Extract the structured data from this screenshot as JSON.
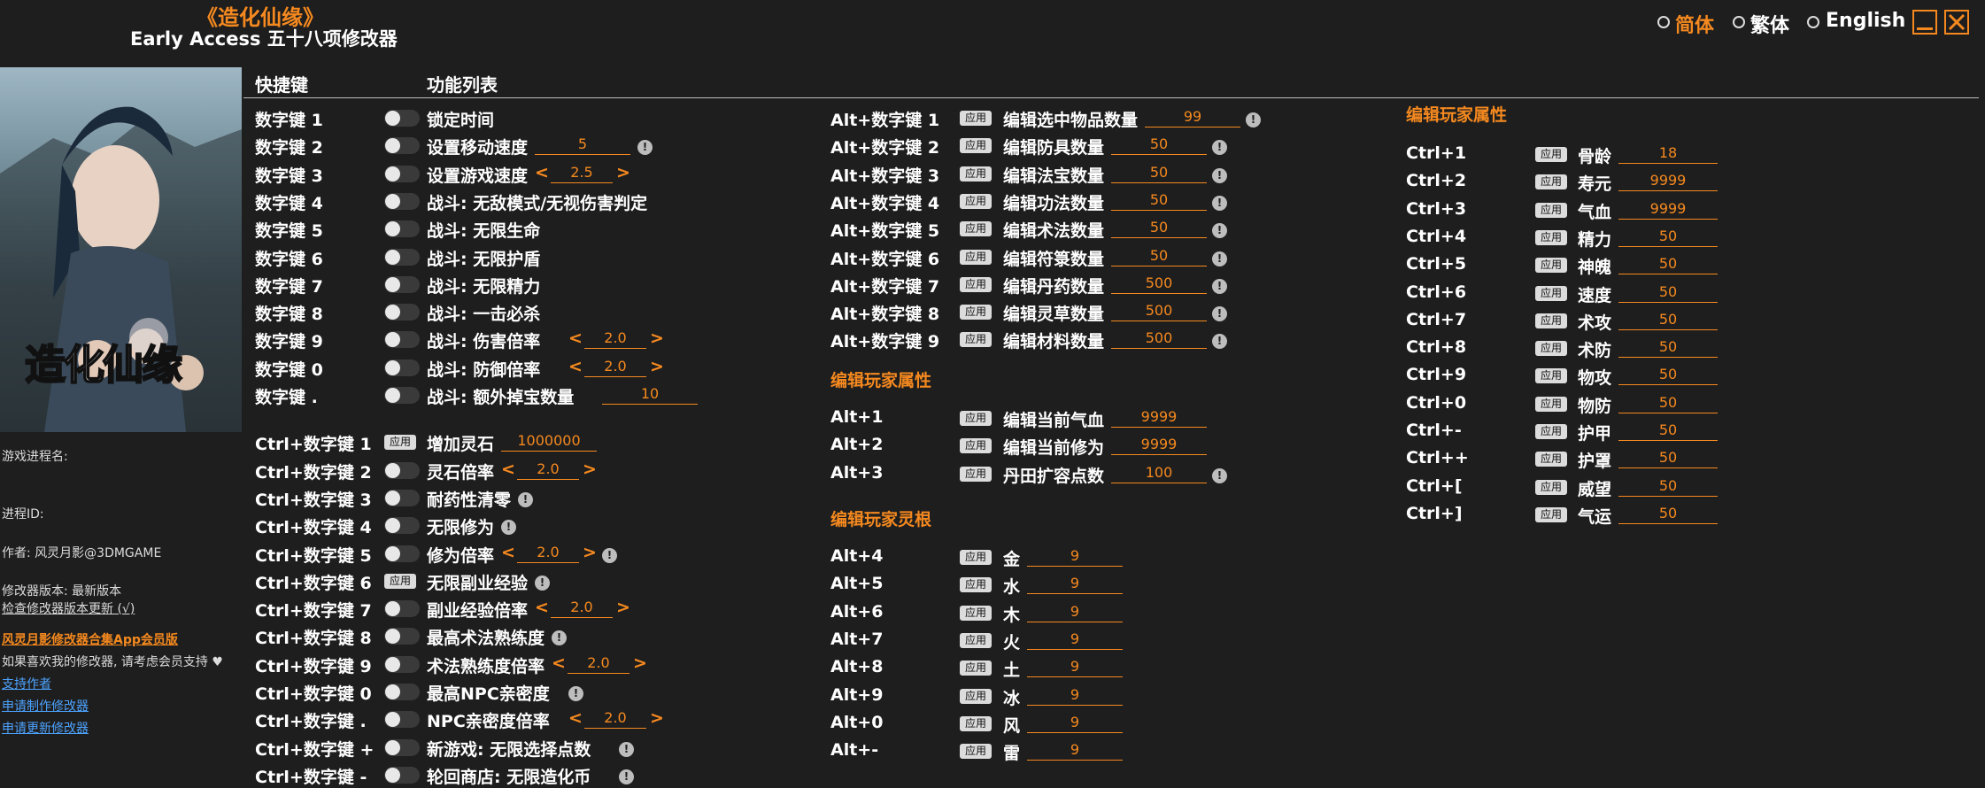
{
  "header": {
    "game_title": "《造化仙缘》",
    "subtitle": "Early Access 五十八项修改器",
    "lang": [
      "简体",
      "繁体",
      "English"
    ],
    "lang_selected": "简体"
  },
  "columns": {
    "hotkey": "快捷键",
    "features": "功能列表"
  },
  "apply_label": "应用",
  "cover_text": "造化仙缘",
  "sidebar": {
    "process_name_label": "游戏进程名:",
    "process_id_label": "进程ID:",
    "author": "作者: 风灵月影@3DMGAME",
    "version": "修改器版本: 最新版本",
    "check_update": "检查修改器版本更新 (√)",
    "app_link": "风灵月影修改器合集App会员版",
    "support_text": "如果喜欢我的修改器, 请考虑会员支持 ♥",
    "support_author": "支持作者",
    "request_make": "申请制作修改器",
    "request_update": "申请更新修改器"
  },
  "col1": [
    {
      "key": "数字键 1",
      "type": "toggle",
      "label": "锁定时间"
    },
    {
      "key": "数字键 2",
      "type": "toggle",
      "label": "设置移动速度",
      "value": "5",
      "info": true
    },
    {
      "key": "数字键 3",
      "type": "toggle",
      "label": "设置游戏速度",
      "value": "2.5",
      "arrows": true
    },
    {
      "key": "数字键 4",
      "type": "toggle",
      "label": "战斗: 无敌模式/无视伤害判定"
    },
    {
      "key": "数字键 5",
      "type": "toggle",
      "label": "战斗: 无限生命"
    },
    {
      "key": "数字键 6",
      "type": "toggle",
      "label": "战斗: 无限护盾"
    },
    {
      "key": "数字键 7",
      "type": "toggle",
      "label": "战斗: 无限精力"
    },
    {
      "key": "数字键 8",
      "type": "toggle",
      "label": "战斗: 一击必杀"
    },
    {
      "key": "数字键 9",
      "type": "toggle",
      "label": "战斗: 伤害倍率",
      "value": "2.0",
      "arrows": true
    },
    {
      "key": "数字键 0",
      "type": "toggle",
      "label": "战斗: 防御倍率",
      "value": "2.0",
      "arrows": true
    },
    {
      "key": "数字键 .",
      "type": "toggle",
      "label": "战斗: 额外掉宝数量",
      "value": "10"
    },
    {
      "key": "Ctrl+数字键 1",
      "type": "apply",
      "label": "增加灵石",
      "value": "1000000"
    },
    {
      "key": "Ctrl+数字键 2",
      "type": "toggle",
      "label": "灵石倍率",
      "value": "2.0",
      "arrows": true
    },
    {
      "key": "Ctrl+数字键 3",
      "type": "toggle",
      "label": "耐药性清零",
      "info": true
    },
    {
      "key": "Ctrl+数字键 4",
      "type": "toggle",
      "label": "无限修为",
      "info": true
    },
    {
      "key": "Ctrl+数字键 5",
      "type": "toggle",
      "label": "修为倍率",
      "value": "2.0",
      "arrows": true,
      "info": true
    },
    {
      "key": "Ctrl+数字键 6",
      "type": "apply",
      "label": "无限副业经验",
      "info": true
    },
    {
      "key": "Ctrl+数字键 7",
      "type": "toggle",
      "label": "副业经验倍率",
      "value": "2.0",
      "arrows": true
    },
    {
      "key": "Ctrl+数字键 8",
      "type": "toggle",
      "label": "最高术法熟练度",
      "info": true
    },
    {
      "key": "Ctrl+数字键 9",
      "type": "toggle",
      "label": "术法熟练度倍率",
      "value": "2.0",
      "arrows": true
    },
    {
      "key": "Ctrl+数字键 0",
      "type": "toggle",
      "label": "最高NPC亲密度",
      "info": true
    },
    {
      "key": "Ctrl+数字键 .",
      "type": "toggle",
      "label": "NPC亲密度倍率",
      "value": "2.0",
      "arrows": true
    },
    {
      "key": "Ctrl+数字键 +",
      "type": "toggle",
      "label": "新游戏: 无限选择点数",
      "info": true
    },
    {
      "key": "Ctrl+数字键 -",
      "type": "toggle",
      "label": "轮回商店: 无限造化币",
      "info": true
    }
  ],
  "col2_items": [
    {
      "key": "Alt+数字键 1",
      "label": "编辑选中物品数量",
      "value": "99"
    },
    {
      "key": "Alt+数字键 2",
      "label": "编辑防具数量",
      "value": "50"
    },
    {
      "key": "Alt+数字键 3",
      "label": "编辑法宝数量",
      "value": "50"
    },
    {
      "key": "Alt+数字键 4",
      "label": "编辑功法数量",
      "value": "50"
    },
    {
      "key": "Alt+数字键 5",
      "label": "编辑术法数量",
      "value": "50"
    },
    {
      "key": "Alt+数字键 6",
      "label": "编辑符箓数量",
      "value": "50"
    },
    {
      "key": "Alt+数字键 7",
      "label": "编辑丹药数量",
      "value": "500"
    },
    {
      "key": "Alt+数字键 8",
      "label": "编辑灵草数量",
      "value": "500"
    },
    {
      "key": "Alt+数字键 9",
      "label": "编辑材料数量",
      "value": "500"
    }
  ],
  "col2_section1": "编辑玩家属性",
  "col2_attrs": [
    {
      "key": "Alt+1",
      "label": "编辑当前气血",
      "value": "9999"
    },
    {
      "key": "Alt+2",
      "label": "编辑当前修为",
      "value": "9999"
    },
    {
      "key": "Alt+3",
      "label": "丹田扩容点数",
      "value": "100",
      "info": true
    }
  ],
  "col2_section2": "编辑玩家灵根",
  "col2_roots": [
    {
      "key": "Alt+4",
      "label": "金",
      "value": "9"
    },
    {
      "key": "Alt+5",
      "label": "水",
      "value": "9"
    },
    {
      "key": "Alt+6",
      "label": "木",
      "value": "9"
    },
    {
      "key": "Alt+7",
      "label": "火",
      "value": "9"
    },
    {
      "key": "Alt+8",
      "label": "土",
      "value": "9"
    },
    {
      "key": "Alt+9",
      "label": "冰",
      "value": "9"
    },
    {
      "key": "Alt+0",
      "label": "风",
      "value": "9"
    },
    {
      "key": "Alt+-",
      "label": "雷",
      "value": "9"
    }
  ],
  "col3_section": "编辑玩家属性",
  "col3": [
    {
      "key": "Ctrl+1",
      "label": "骨龄",
      "value": "18"
    },
    {
      "key": "Ctrl+2",
      "label": "寿元",
      "value": "9999"
    },
    {
      "key": "Ctrl+3",
      "label": "气血",
      "value": "9999"
    },
    {
      "key": "Ctrl+4",
      "label": "精力",
      "value": "50"
    },
    {
      "key": "Ctrl+5",
      "label": "神魄",
      "value": "50"
    },
    {
      "key": "Ctrl+6",
      "label": "速度",
      "value": "50"
    },
    {
      "key": "Ctrl+7",
      "label": "术攻",
      "value": "50"
    },
    {
      "key": "Ctrl+8",
      "label": "术防",
      "value": "50"
    },
    {
      "key": "Ctrl+9",
      "label": "物攻",
      "value": "50"
    },
    {
      "key": "Ctrl+0",
      "label": "物防",
      "value": "50"
    },
    {
      "key": "Ctrl+-",
      "label": "护甲",
      "value": "50"
    },
    {
      "key": "Ctrl++",
      "label": "护罩",
      "value": "50"
    },
    {
      "key": "Ctrl+[",
      "label": "威望",
      "value": "50"
    },
    {
      "key": "Ctrl+]",
      "label": "气运",
      "value": "50"
    }
  ]
}
